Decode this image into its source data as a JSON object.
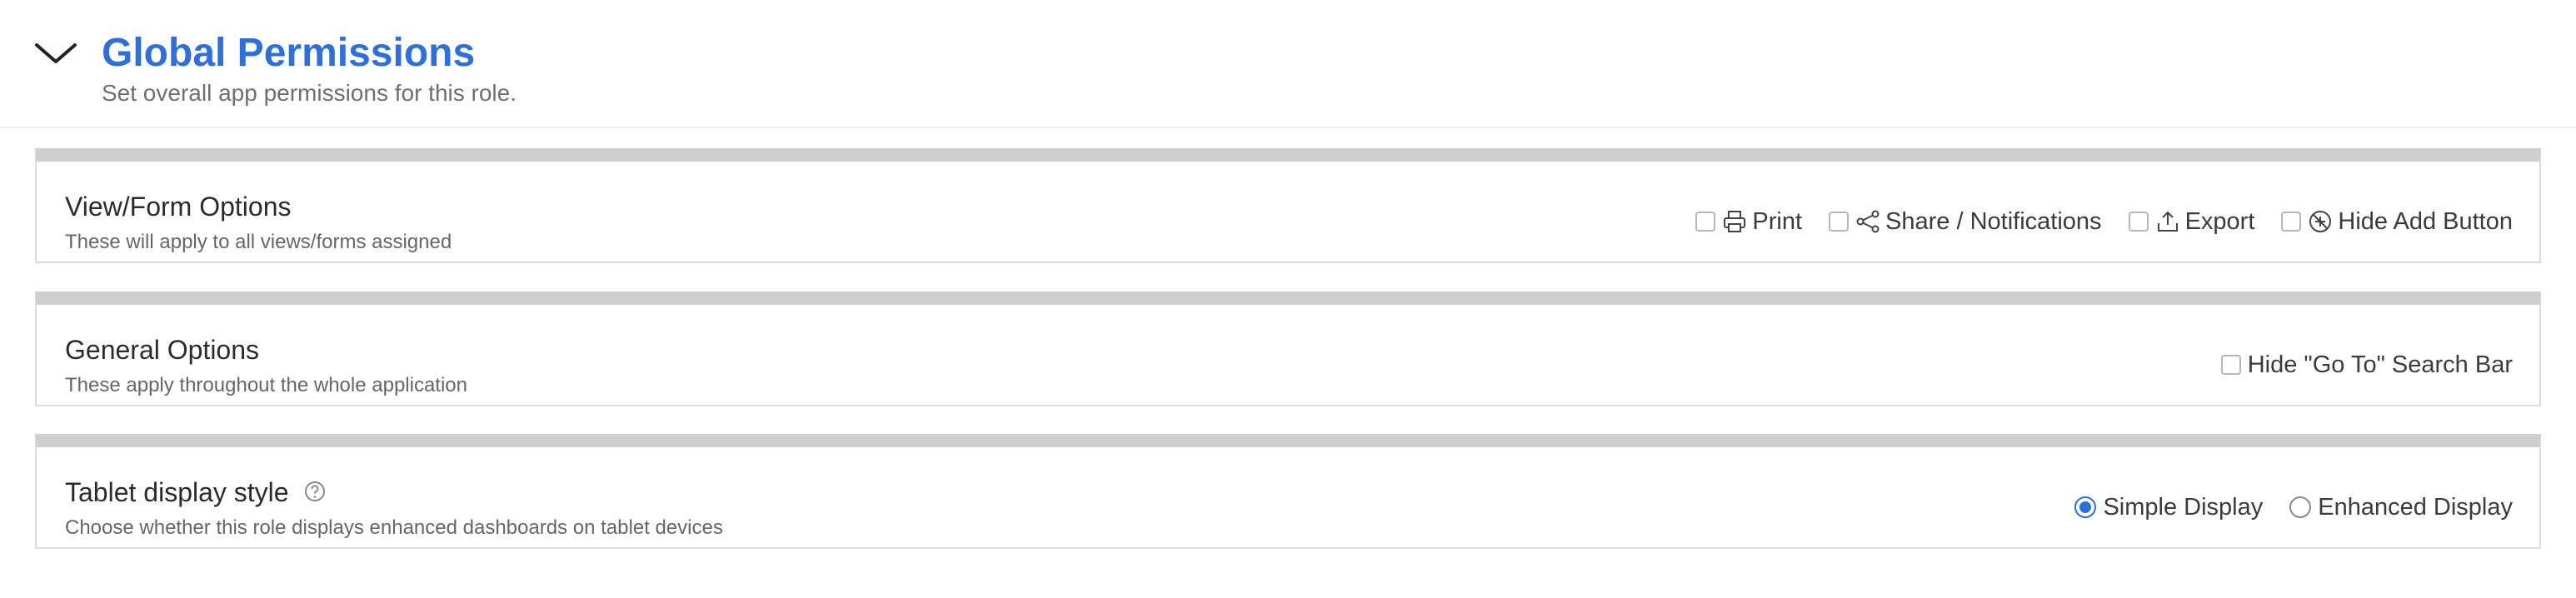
{
  "section": {
    "title": "Global Permissions",
    "subtitle": "Set overall app permissions for this role."
  },
  "cards": [
    {
      "title": "View/Form Options",
      "description": "These will apply to all views/forms assigned",
      "options": [
        {
          "label": "Print",
          "icon": "printer-icon",
          "checked": false
        },
        {
          "label": "Share / Notifications",
          "icon": "share-icon",
          "checked": false
        },
        {
          "label": "Export",
          "icon": "export-icon",
          "checked": false
        },
        {
          "label": "Hide Add Button",
          "icon": "no-add-icon",
          "checked": false
        }
      ]
    },
    {
      "title": "General Options",
      "description": "These apply throughout the whole application",
      "options": [
        {
          "label": "Hide \"Go To\" Search Bar",
          "checked": false
        }
      ]
    },
    {
      "title": "Tablet display style",
      "description": "Choose whether this role displays enhanced dashboards on tablet devices",
      "help_icon": "help-circle-icon",
      "radios": [
        {
          "label": "Simple Display",
          "selected": true
        },
        {
          "label": "Enhanced Display",
          "selected": false
        }
      ]
    }
  ],
  "colors": {
    "accent": "#2f6fd9",
    "card_top_bar": "#cfcfcf",
    "muted_text": "#6f6f6f"
  }
}
